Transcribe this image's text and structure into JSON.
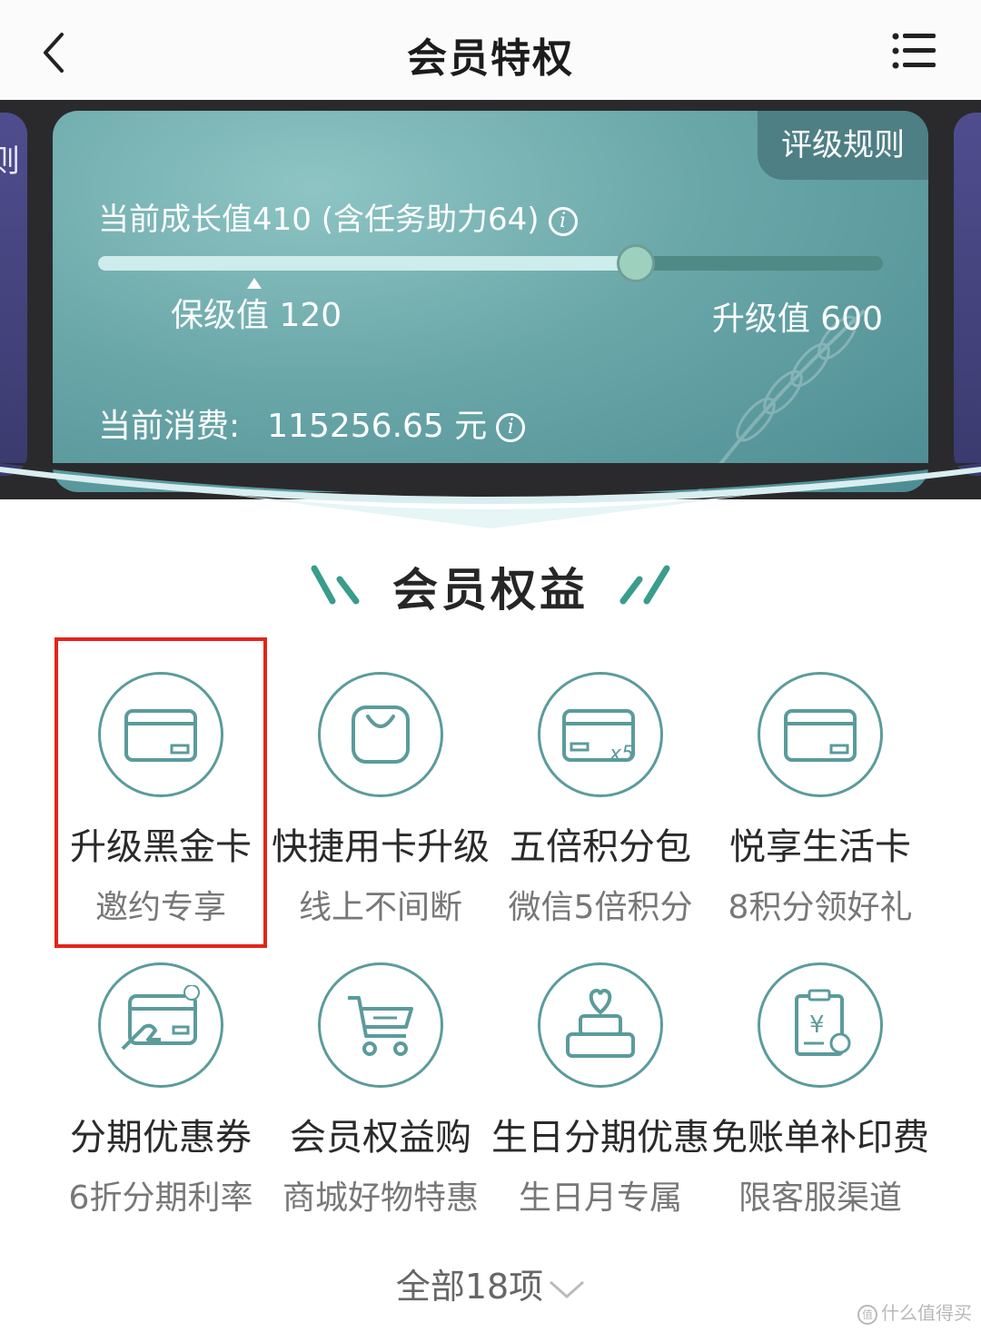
{
  "header": {
    "title": "会员特权"
  },
  "card": {
    "rules_tab": "评级规则",
    "growth_text": "当前成长值410 (含任务助力64)",
    "progress_fraction": 0.685,
    "keep_label": "保级值 120",
    "upgrade_label": "升级值 600",
    "spend_label": "当前消费:",
    "spend_value": "115256.65 元",
    "left_card_partial_text": "则"
  },
  "section": {
    "title": "会员权益"
  },
  "benefits": [
    {
      "title": "升级黑金卡",
      "subtitle": "邀约专享",
      "icon": "card-icon"
    },
    {
      "title": "快捷用卡升级",
      "subtitle": "线上不间断",
      "icon": "bag-icon"
    },
    {
      "title": "五倍积分包",
      "subtitle": "微信5倍积分",
      "icon": "card-x5-icon",
      "icon_text": "x5"
    },
    {
      "title": "悦享生活卡",
      "subtitle": "8积分领好礼",
      "icon": "card-icon"
    },
    {
      "title": "分期优惠券",
      "subtitle": "6折分期利率",
      "icon": "card-hand-icon"
    },
    {
      "title": "会员权益购",
      "subtitle": "商城好物特惠",
      "icon": "cart-icon"
    },
    {
      "title": "生日分期优惠",
      "subtitle": "生日月专属",
      "icon": "cake-icon"
    },
    {
      "title": "免账单补印费",
      "subtitle": "限客服渠道",
      "icon": "bill-icon",
      "icon_text": "¥"
    }
  ],
  "footer": {
    "view_all": "全部18项",
    "watermark": "什么值得买"
  },
  "colors": {
    "accent": "#5b9b9b",
    "highlight": "#e3241b",
    "card": "#6aa7a9"
  }
}
